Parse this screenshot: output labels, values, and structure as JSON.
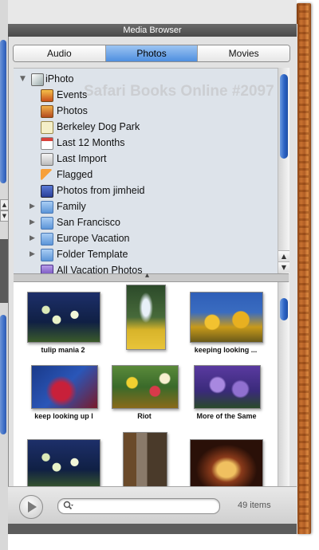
{
  "window": {
    "title": "Media Browser"
  },
  "tabs": [
    {
      "label": "Audio",
      "active": false
    },
    {
      "label": "Photos",
      "active": true
    },
    {
      "label": "Movies",
      "active": false
    }
  ],
  "watermark": "Safari Books Online #2097",
  "source_list": [
    {
      "label": "iPhoto",
      "icon": "iphoto-icon",
      "level": 0,
      "disclosure": "expanded"
    },
    {
      "label": "Events",
      "icon": "events-icon",
      "level": 1,
      "disclosure": "none"
    },
    {
      "label": "Photos",
      "icon": "photos-icon",
      "level": 1,
      "disclosure": "none"
    },
    {
      "label": "Berkeley Dog Park",
      "icon": "album-icon",
      "level": 1,
      "disclosure": "none"
    },
    {
      "label": "Last 12 Months",
      "icon": "calendar-icon",
      "level": 1,
      "disclosure": "none"
    },
    {
      "label": "Last Import",
      "icon": "import-icon",
      "level": 1,
      "disclosure": "none"
    },
    {
      "label": "Flagged",
      "icon": "flag-icon",
      "level": 1,
      "disclosure": "none"
    },
    {
      "label": "Photos from jimheid",
      "icon": "shared-photos-icon",
      "level": 1,
      "disclosure": "none"
    },
    {
      "label": "Family",
      "icon": "folder-icon",
      "level": 1,
      "disclosure": "collapsed"
    },
    {
      "label": "San Francisco",
      "icon": "folder-icon",
      "level": 1,
      "disclosure": "collapsed"
    },
    {
      "label": "Europe Vacation",
      "icon": "folder-icon",
      "level": 1,
      "disclosure": "collapsed"
    },
    {
      "label": "Folder Template",
      "icon": "folder-icon",
      "level": 1,
      "disclosure": "collapsed"
    },
    {
      "label": "All Vacation Photos",
      "icon": "smart-album-icon",
      "level": 1,
      "disclosure": "none"
    }
  ],
  "photos": [
    {
      "caption": "tulip mania 2",
      "scene": "white tulips on dark blue"
    },
    {
      "caption": "",
      "scene": "fountain with yellow flowers"
    },
    {
      "caption": "keeping looking ...",
      "scene": "yellow flowers against blue sky"
    },
    {
      "caption": "keep looking up l",
      "scene": "red tree against blue sky"
    },
    {
      "caption": "Riot",
      "scene": "mixed flower bed"
    },
    {
      "caption": "More of the Same",
      "scene": "purple flowers"
    },
    {
      "caption": "",
      "scene": "white tulips on dark blue"
    },
    {
      "caption": "",
      "scene": "street with buildings"
    },
    {
      "caption": "",
      "scene": "ornate lit archway at night"
    }
  ],
  "search": {
    "value": "",
    "placeholder": ""
  },
  "status": {
    "item_count": "49 items"
  },
  "colors": {
    "selected_tab": "#5a96e3",
    "scroll_thumb": "#2c63c4",
    "source_bg": "#dde3ea",
    "wood": "#b8601f"
  }
}
